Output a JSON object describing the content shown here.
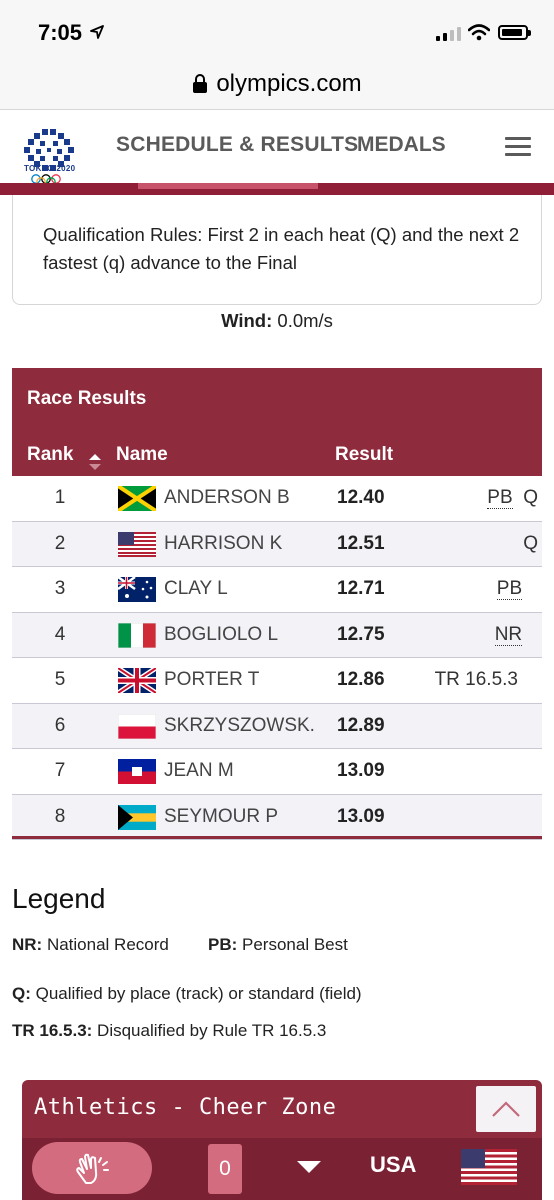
{
  "status_bar": {
    "time": "7:05"
  },
  "browser": {
    "url": "olympics.com"
  },
  "header": {
    "logo_caption": "TOKYO 2020",
    "nav": [
      {
        "label": "SCHEDULE & RESULTS"
      },
      {
        "label": "MEDALS"
      }
    ],
    "menu_icon": "hamburger-icon"
  },
  "info": {
    "qualification_rules": "Qualification Rules: First 2 in each heat (Q) and the next 2 fastest (q) advance to the Final",
    "wind_label": "Wind:",
    "wind_value": "0.0m/s"
  },
  "results": {
    "title": "Race Results",
    "columns": {
      "rank": "Rank",
      "name": "Name",
      "result": "Result"
    },
    "rows": [
      {
        "rank": "1",
        "flag": "JAM",
        "name": "ANDERSON B",
        "result": "12.40",
        "note1": "PB",
        "note2": "Q"
      },
      {
        "rank": "2",
        "flag": "USA",
        "name": "HARRISON K",
        "result": "12.51",
        "note1": "",
        "note2": "Q"
      },
      {
        "rank": "3",
        "flag": "AUS",
        "name": "CLAY L",
        "result": "12.71",
        "note1": "PB",
        "note2": ""
      },
      {
        "rank": "4",
        "flag": "ITA",
        "name": "BOGLIOLO L",
        "result": "12.75",
        "note1": "NR",
        "note2": ""
      },
      {
        "rank": "5",
        "flag": "GBR",
        "name": "PORTER T",
        "result": "12.86",
        "note1": "TR 16.5.3",
        "note2": ""
      },
      {
        "rank": "6",
        "flag": "POL",
        "name": "SKRZYSZOWSK...",
        "result": "12.89",
        "note1": "",
        "note2": ""
      },
      {
        "rank": "7",
        "flag": "HAI",
        "name": "JEAN M",
        "result": "13.09",
        "note1": "",
        "note2": ""
      },
      {
        "rank": "8",
        "flag": "BAH",
        "name": "SEYMOUR P",
        "result": "13.09",
        "note1": "",
        "note2": ""
      }
    ]
  },
  "legend": {
    "title": "Legend",
    "items": [
      {
        "key": "NR:",
        "desc": "National Record"
      },
      {
        "key": "PB:",
        "desc": "Personal Best"
      },
      {
        "key": "Q:",
        "desc": "Qualified by place (track) or standard (field)"
      },
      {
        "key": "TR 16.5.3:",
        "desc": "Disqualified by Rule TR 16.5.3"
      }
    ]
  },
  "cheer_zone": {
    "title": "Athletics - Cheer Zone",
    "count": "0",
    "country": "USA"
  },
  "colors": {
    "brand": "#8e2b3c",
    "brand_light": "#d46c80",
    "row_alt": "#f2f2f7"
  }
}
